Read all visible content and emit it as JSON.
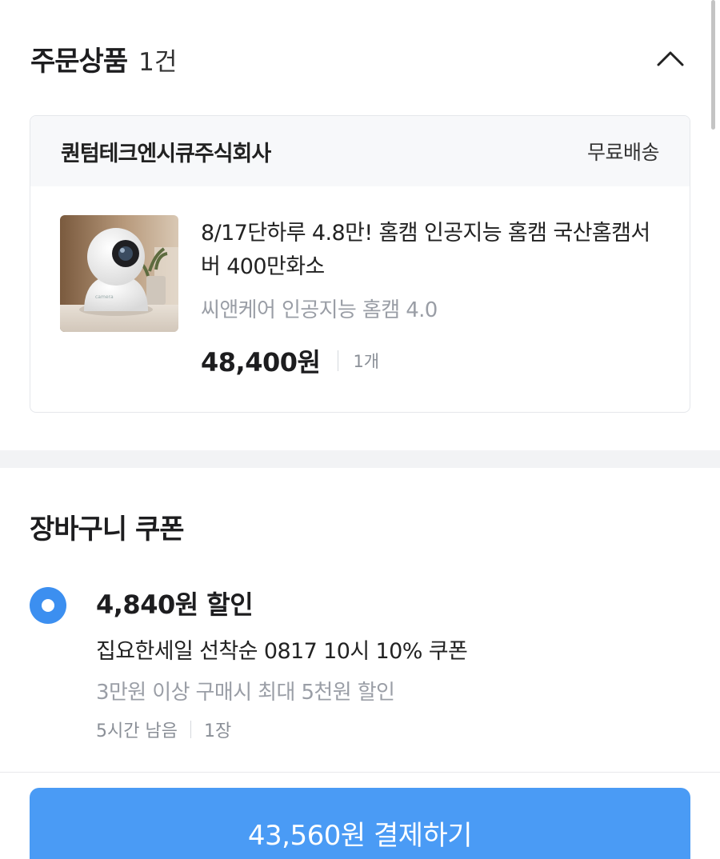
{
  "order_section": {
    "title": "주문상품",
    "count": "1건",
    "collapse_icon": "chevron-up-icon"
  },
  "seller": {
    "name": "퀀텀테크엔시큐주식회사",
    "shipping": "무료배송"
  },
  "product": {
    "title": "8/17단하루 4.8만! 홈캠 인공지능 홈캠 국산홈캠서버 400만화소",
    "option": "씨앤케어 인공지능 홈캠 4.0",
    "price": "48,400원",
    "quantity": "1개",
    "image": "home-camera-photo"
  },
  "coupon_section": {
    "title": "장바구니 쿠폰",
    "selected": true,
    "discount": "4,840원 할인",
    "name": "집요한세일 선착순 0817 10시 10% 쿠폰",
    "condition": "3만원 이상 구매시 최대 5천원 할인",
    "time_left": "5시간 남음",
    "count": "1장"
  },
  "pay_button": {
    "label": "43,560원 결제하기"
  },
  "colors": {
    "accent": "#4a9bf5",
    "radio": "#3c8ff0",
    "muted_text": "#9a9ea6",
    "card_header_bg": "#f7f8fa",
    "divider_band": "#f2f3f5"
  }
}
